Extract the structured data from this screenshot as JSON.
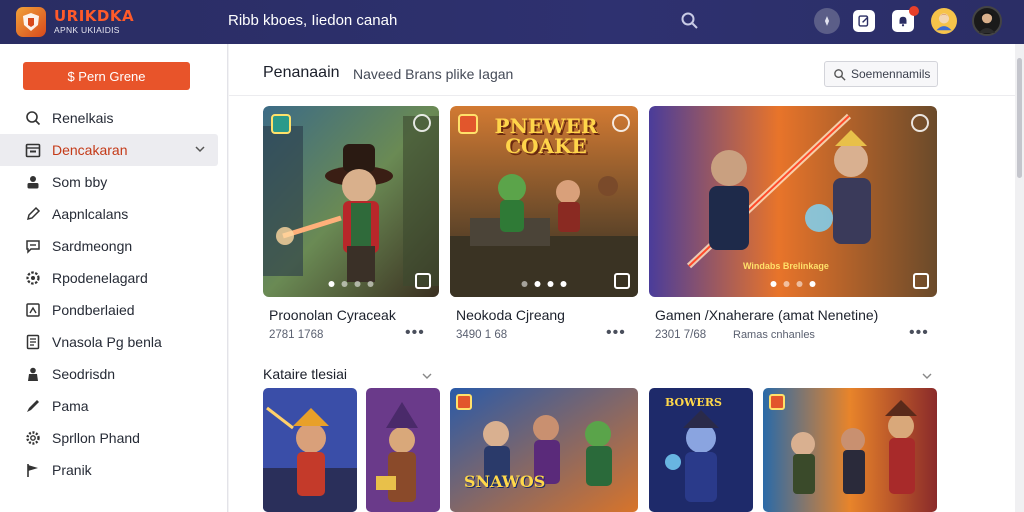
{
  "app": {
    "logo_title": "URIKDKA",
    "logo_subtitle": "APNK UKIAIDIS",
    "header_title": "Ribb kboes, Iiedon canah"
  },
  "topbar_icons": [
    "search-icon",
    "compass-icon",
    "edit-icon",
    "bell-icon",
    "avatar",
    "avatar"
  ],
  "sidebar": {
    "primary_button": "$ Pern Grene",
    "items": [
      {
        "label": "Renelkais",
        "icon": "search-icon"
      },
      {
        "label": "Dencakaran",
        "icon": "calendar-icon",
        "active": true
      },
      {
        "label": "Som bby",
        "icon": "user-icon"
      },
      {
        "label": "Aapnlcalans",
        "icon": "pen-icon"
      },
      {
        "label": "Sardmeongn",
        "icon": "chat-icon"
      },
      {
        "label": "Rpodenelagard",
        "icon": "gear-icon"
      },
      {
        "label": "Pondberlaied",
        "icon": "doc-icon"
      },
      {
        "label": "Vnasola Pg benla",
        "icon": "file-icon"
      },
      {
        "label": "Seodrisdn",
        "icon": "person-icon"
      },
      {
        "label": "Pama",
        "icon": "brush-icon"
      },
      {
        "label": "Sprllon Phand",
        "icon": "settings-icon"
      },
      {
        "label": "Pranik",
        "icon": "flag-icon"
      }
    ]
  },
  "main": {
    "title": "Penanaain",
    "subtitle": "Naveed Brans plike Iagan",
    "search_label": "Soemennamils",
    "featured": [
      {
        "title": "Proonolan Cyraceak",
        "meta": "2781 1768",
        "more": "•••"
      },
      {
        "title": "Neokoda Cjreang",
        "meta": "3490 1 68",
        "more": "•••"
      },
      {
        "title": "Gamen /Xnaherare (amat Nenetine)",
        "meta": "2301 7/68",
        "more": "•••",
        "sub": "Ramas cnhanles"
      }
    ],
    "featured_art_text": {
      "card2_banner": "PNEWER COAKE",
      "card3_caption": "Windabs Brelinkage"
    },
    "section_title": "Kataire tlesiai",
    "thumb_art_text": [
      "SNAWOS",
      "BOWERS"
    ]
  },
  "colors": {
    "topbar": "#2c2f68",
    "accent": "#e8542a",
    "active_text": "#c43a18"
  }
}
